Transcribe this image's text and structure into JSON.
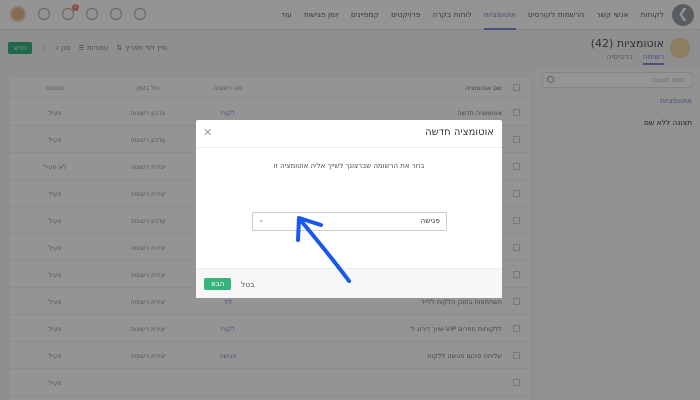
{
  "nav": {
    "items": [
      "לקוחות",
      "אנשי קשר",
      "הרשמות לקורסים",
      "אוטומציות",
      "לוחות בקרה",
      "פרויקטים",
      "קמפיינים",
      "יומן פגישות",
      "עוד"
    ],
    "active_index": 3,
    "notification_count": "1"
  },
  "header": {
    "title": "אוטומציות (42)",
    "tabs": [
      "רשימה",
      "כרטיסיה"
    ],
    "active_tab": 0
  },
  "toolbar": {
    "new_label": "חדש",
    "sort_label": "מיין לפי תאריך",
    "columns_label": "עמודות",
    "filter_label": "סנן"
  },
  "sidebar": {
    "search_placeholder": "חפש תצוגה",
    "items": [
      "אוטומציות",
      "תצוגה ללא שם"
    ],
    "active_index": 0
  },
  "table": {
    "columns": [
      "שם אוטומציה",
      "סוג רשומה",
      "חל בזמן",
      "סטטוס"
    ],
    "rows": [
      {
        "name": "אוטומציה חדשה",
        "type": "לקוח",
        "trigger": "עדכון רשומה",
        "status": "פעיל"
      },
      {
        "name": "",
        "type": "לקוח",
        "trigger": "עדכון רשומה",
        "status": "פעיל"
      },
      {
        "name": "",
        "type": "",
        "trigger": "יצירת רשומה",
        "status": "לא פעיל"
      },
      {
        "name": "",
        "type": "",
        "trigger": "יצירת רשומה",
        "status": "פעיל"
      },
      {
        "name": "",
        "type": "",
        "trigger": "עדכון רשומה",
        "status": "פעיל"
      },
      {
        "name": "",
        "type": "",
        "trigger": "יצירת רשומה",
        "status": "פעיל"
      },
      {
        "name": "",
        "type": "",
        "trigger": "יצירת רשומה",
        "status": "פעיל"
      },
      {
        "name": "השתתפות בתוכן הלקוח ללייד",
        "type": "ליד",
        "trigger": "יצירת רשומה",
        "status": "פעיל"
      },
      {
        "name": "שיוך דירוג ל-VIP ללקוחות חוזרים",
        "type": "לקוח",
        "trigger": "יצירת רשומה",
        "status": "פעיל"
      },
      {
        "name": "שליחת סיכום פגישה ללקוח",
        "type": "פגישה",
        "trigger": "יצירת רשומה",
        "status": "פעיל"
      },
      {
        "name": "",
        "type": "",
        "trigger": "",
        "status": "פעיל"
      }
    ]
  },
  "modal": {
    "title": "אוטומציה חדשה",
    "instruction": "בחר את הרשומה שברצונך לשייך אליה אוטומציה זו",
    "select_value": "פגישה",
    "next_label": "הבא",
    "cancel_label": "בטל"
  },
  "colors": {
    "accent": "#7d8fd6",
    "primary_button": "#36b37e",
    "annotation_arrow": "#1a56f0"
  }
}
